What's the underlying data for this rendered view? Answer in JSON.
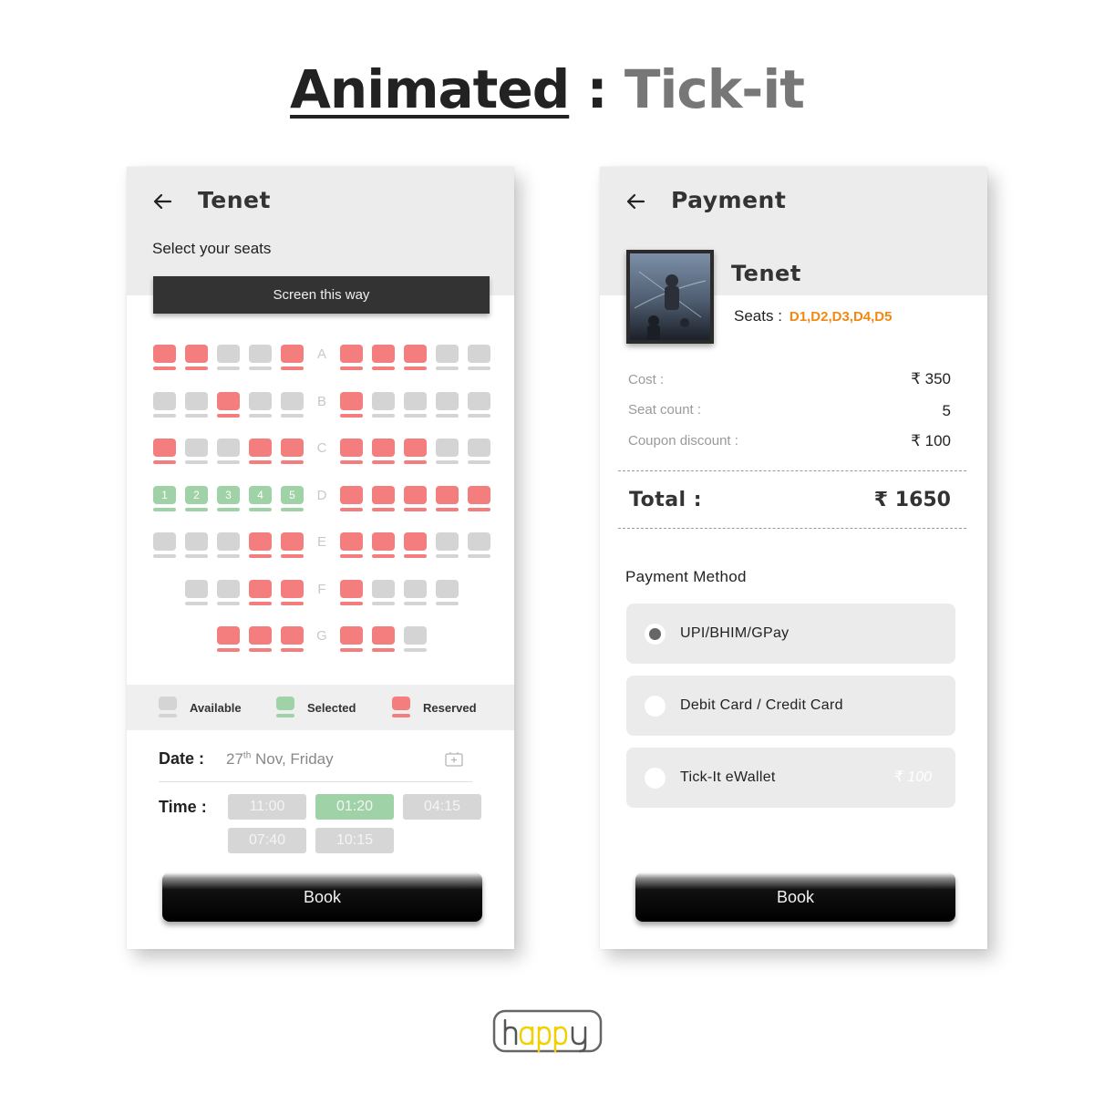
{
  "page": {
    "title_part1": "Animated",
    "title_separator": ":",
    "title_part2": "Tick-it"
  },
  "colors": {
    "available": "#d4d4d4",
    "reserved": "#f47e7e",
    "selected": "#9fd3a7",
    "accent_orange": "#f2880f"
  },
  "seat_screen": {
    "back_icon": "arrow-left-icon",
    "title": "Tenet",
    "subtitle": "Select your seats",
    "screen_label": "Screen this way",
    "rows": [
      {
        "letter": "A",
        "left": [
          "reserved",
          "reserved",
          "available",
          "available",
          "reserved"
        ],
        "right": [
          "reserved",
          "reserved",
          "reserved",
          "available",
          "available"
        ]
      },
      {
        "letter": "B",
        "left": [
          "available",
          "available",
          "reserved",
          "available",
          "available"
        ],
        "right": [
          "reserved",
          "available",
          "available",
          "available",
          "available"
        ]
      },
      {
        "letter": "C",
        "left": [
          "reserved",
          "available",
          "available",
          "reserved",
          "reserved"
        ],
        "right": [
          "reserved",
          "reserved",
          "reserved",
          "available",
          "available"
        ]
      },
      {
        "letter": "D",
        "left": [
          "selected",
          "selected",
          "selected",
          "selected",
          "selected"
        ],
        "left_labels": [
          "1",
          "2",
          "3",
          "4",
          "5"
        ],
        "right": [
          "reserved",
          "reserved",
          "reserved",
          "reserved",
          "reserved"
        ]
      },
      {
        "letter": "E",
        "left": [
          "available",
          "available",
          "available",
          "reserved",
          "reserved"
        ],
        "right": [
          "reserved",
          "reserved",
          "reserved",
          "available",
          "available"
        ]
      },
      {
        "letter": "F",
        "left": [
          null,
          "available",
          "available",
          "reserved",
          "reserved"
        ],
        "right": [
          "reserved",
          "available",
          "available",
          "available",
          null
        ]
      },
      {
        "letter": "G",
        "left": [
          null,
          null,
          "reserved",
          "reserved",
          "reserved"
        ],
        "right": [
          "reserved",
          "reserved",
          "available",
          null,
          null
        ]
      }
    ],
    "legend": [
      {
        "label": "Available",
        "status": "available"
      },
      {
        "label": "Selected",
        "status": "selected"
      },
      {
        "label": "Reserved",
        "status": "reserved"
      }
    ],
    "date_label": "Date :",
    "date_day": "27",
    "date_suffix": "th",
    "date_rest": " Nov, Friday",
    "calendar_icon": "calendar-plus-icon",
    "time_label": "Time :",
    "times": [
      {
        "value": "11:00",
        "selected": false
      },
      {
        "value": "01:20",
        "selected": true
      },
      {
        "value": "04:15",
        "selected": false
      },
      {
        "value": "07:40",
        "selected": false
      },
      {
        "value": "10:15",
        "selected": false
      }
    ],
    "book_label": "Book"
  },
  "payment_screen": {
    "back_icon": "arrow-left-icon",
    "title": "Payment",
    "movie_title": "Tenet",
    "seats_label": "Seats :",
    "seats_value": "D1,D2,D3,D4,D5",
    "cost_label": "Cost :",
    "cost_value": "₹ 350",
    "seat_count_label": "Seat count :",
    "seat_count_value": "5",
    "coupon_label": "Coupon discount :",
    "coupon_value": "₹ 100",
    "total_label": "Total :",
    "total_value": "₹ 1650",
    "payment_method_title": "Payment Method",
    "methods": [
      {
        "label": "UPI/BHIM/GPay",
        "selected": true,
        "balance": ""
      },
      {
        "label": "Debit Card / Credit Card",
        "selected": false,
        "balance": ""
      },
      {
        "label": "Tick-It eWallet",
        "selected": false,
        "balance": "₹ 100"
      }
    ],
    "book_label": "Book"
  },
  "brand": {
    "logo_text": "happy"
  }
}
